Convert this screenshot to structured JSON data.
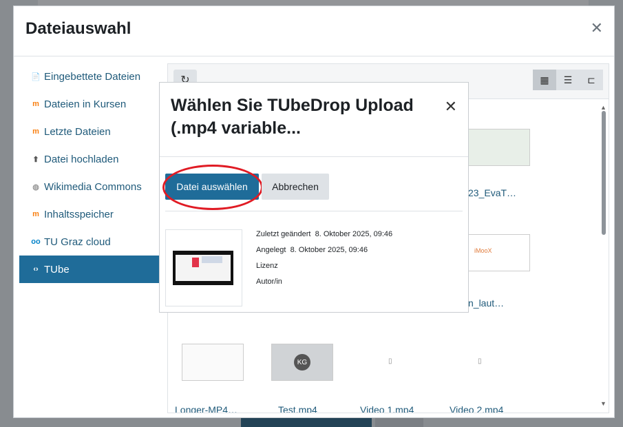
{
  "filepicker": {
    "title": "Dateiauswahl",
    "close_icon": "close-icon",
    "repositories": [
      {
        "label": "Eingebettete Dateien",
        "icon": "embedded-files-icon",
        "icon_color": "#c0392b",
        "glyph": "📄",
        "active": false
      },
      {
        "label": "Dateien in Kursen",
        "icon": "moodle-icon",
        "icon_color": "#f98012",
        "glyph": "m",
        "active": false
      },
      {
        "label": "Letzte Dateien",
        "icon": "moodle-icon",
        "icon_color": "#f98012",
        "glyph": "m",
        "active": false
      },
      {
        "label": "Datei hochladen",
        "icon": "upload-icon",
        "icon_color": "#555555",
        "glyph": "⬆",
        "active": false
      },
      {
        "label": "Wikimedia Commons",
        "icon": "wikimedia-icon",
        "icon_color": "#999999",
        "glyph": "◍",
        "active": false
      },
      {
        "label": "Inhaltsspeicher",
        "icon": "moodle-icon",
        "icon_color": "#f98012",
        "glyph": "m",
        "active": false
      },
      {
        "label": "TU Graz cloud",
        "icon": "nextcloud-icon",
        "icon_color": "#0082c9",
        "glyph": "oo",
        "active": false
      },
      {
        "label": "TUbe",
        "icon": "tube-icon",
        "icon_color": "#2ecc71",
        "glyph": "‹›",
        "active": true
      }
    ],
    "toolbar": {
      "refresh_icon": "refresh-icon",
      "views": [
        "grid-view-icon",
        "list-view-icon",
        "tree-view-icon"
      ]
    },
    "files": {
      "row1_label": "23_EvaT…",
      "row2_label": "n_laut…",
      "bottom_row": [
        {
          "label": "Longer-MP4…"
        },
        {
          "label": "Test.mp4"
        },
        {
          "label": "Video 1.mp4"
        },
        {
          "label": "Video 2.mp4"
        }
      ],
      "avatar_initials": "KG",
      "logo_text": "iMooX"
    }
  },
  "dialog": {
    "title": "Wählen Sie TUbeDrop Upload (.mp4 variable...",
    "select_button": "Datei auswählen",
    "cancel_button": "Abbrechen",
    "meta": {
      "modified_label": "Zuletzt geändert",
      "modified_value": "8. Oktober 2025, 09:46",
      "created_label": "Angelegt",
      "created_value": "8. Oktober 2025, 09:46",
      "license_label": "Lizenz",
      "author_label": "Autor/in"
    }
  },
  "colors": {
    "accent": "#1f6c99",
    "highlight_ring": "#e01b24",
    "link": "#1f5a7a"
  }
}
